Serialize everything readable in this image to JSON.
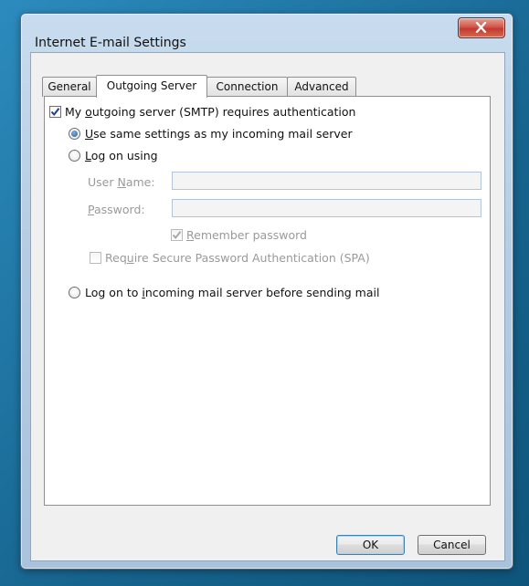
{
  "window": {
    "title": "Internet E-mail Settings"
  },
  "tabs": [
    {
      "label": "General",
      "active": false
    },
    {
      "label": "Outgoing Server",
      "active": true
    },
    {
      "label": "Connection",
      "active": false
    },
    {
      "label": "Advanced",
      "active": false
    }
  ],
  "outgoing": {
    "smtp_auth": {
      "pre": "My ",
      "accel": "o",
      "post": "utgoing server (SMTP) requires authentication",
      "checked": true
    },
    "use_same": {
      "pre": "",
      "accel": "U",
      "post": "se same settings as my incoming mail server",
      "selected": true
    },
    "log_on_using": {
      "pre": "",
      "accel": "L",
      "post": "og on using",
      "selected": false
    },
    "user_name": {
      "pre": "User ",
      "accel": "N",
      "post": "ame:",
      "value": ""
    },
    "password": {
      "pre": "",
      "accel": "P",
      "post": "assword:",
      "value": ""
    },
    "remember": {
      "pre": "",
      "accel": "R",
      "post": "emember password",
      "checked": true,
      "enabled": false
    },
    "spa": {
      "pre": "Req",
      "accel": "u",
      "post": "ire Secure Password Authentication (SPA)",
      "checked": false,
      "enabled": false
    },
    "log_on_incoming": {
      "pre": "Log on to ",
      "accel": "i",
      "post": "ncoming mail server before sending mail",
      "selected": false
    }
  },
  "buttons": {
    "ok": "OK",
    "cancel": "Cancel"
  },
  "icons": {
    "close": "close-icon",
    "check": "checkmark-icon"
  },
  "colors": {
    "close_button": "#c84535",
    "window_frame": "#b6cde4",
    "background": "#1a6f9a"
  }
}
